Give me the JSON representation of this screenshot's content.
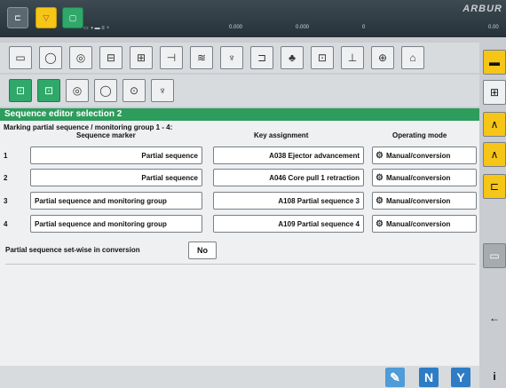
{
  "brand": "ARBUR",
  "status": {
    "v1": "0.000",
    "v2": "0.000",
    "v3": "0",
    "v4": "0.00"
  },
  "header": {
    "title": "Sequence editor selection 2"
  },
  "subtitle": "Marking partial sequence / monitoring group 1 - 4:",
  "columns": {
    "marker": "Sequence marker",
    "key": "Key assignment",
    "mode": "Operating mode"
  },
  "rows": [
    {
      "num": "1",
      "marker": "Partial sequence",
      "key": "A038 Ejector advancement",
      "mode": "Manual/conversion"
    },
    {
      "num": "2",
      "marker": "Partial sequence",
      "key": "A046 Core pull 1 retraction",
      "mode": "Manual/conversion"
    },
    {
      "num": "3",
      "marker": "Partial sequence and monitoring group",
      "key": "A108 Partial sequence 3",
      "mode": "Manual/conversion"
    },
    {
      "num": "4",
      "marker": "Partial sequence and monitoring group",
      "key": "A109 Partial sequence 4",
      "mode": "Manual/conversion"
    }
  ],
  "setwise": {
    "label": "Partial sequence set-wise in conversion",
    "value": "No"
  },
  "buttons": {
    "n": "N",
    "y": "Y",
    "i": "i"
  },
  "colors": {
    "accent_green": "#2d9c5c",
    "accent_yellow": "#f5c518",
    "accent_blue": "#2e7cc4"
  }
}
